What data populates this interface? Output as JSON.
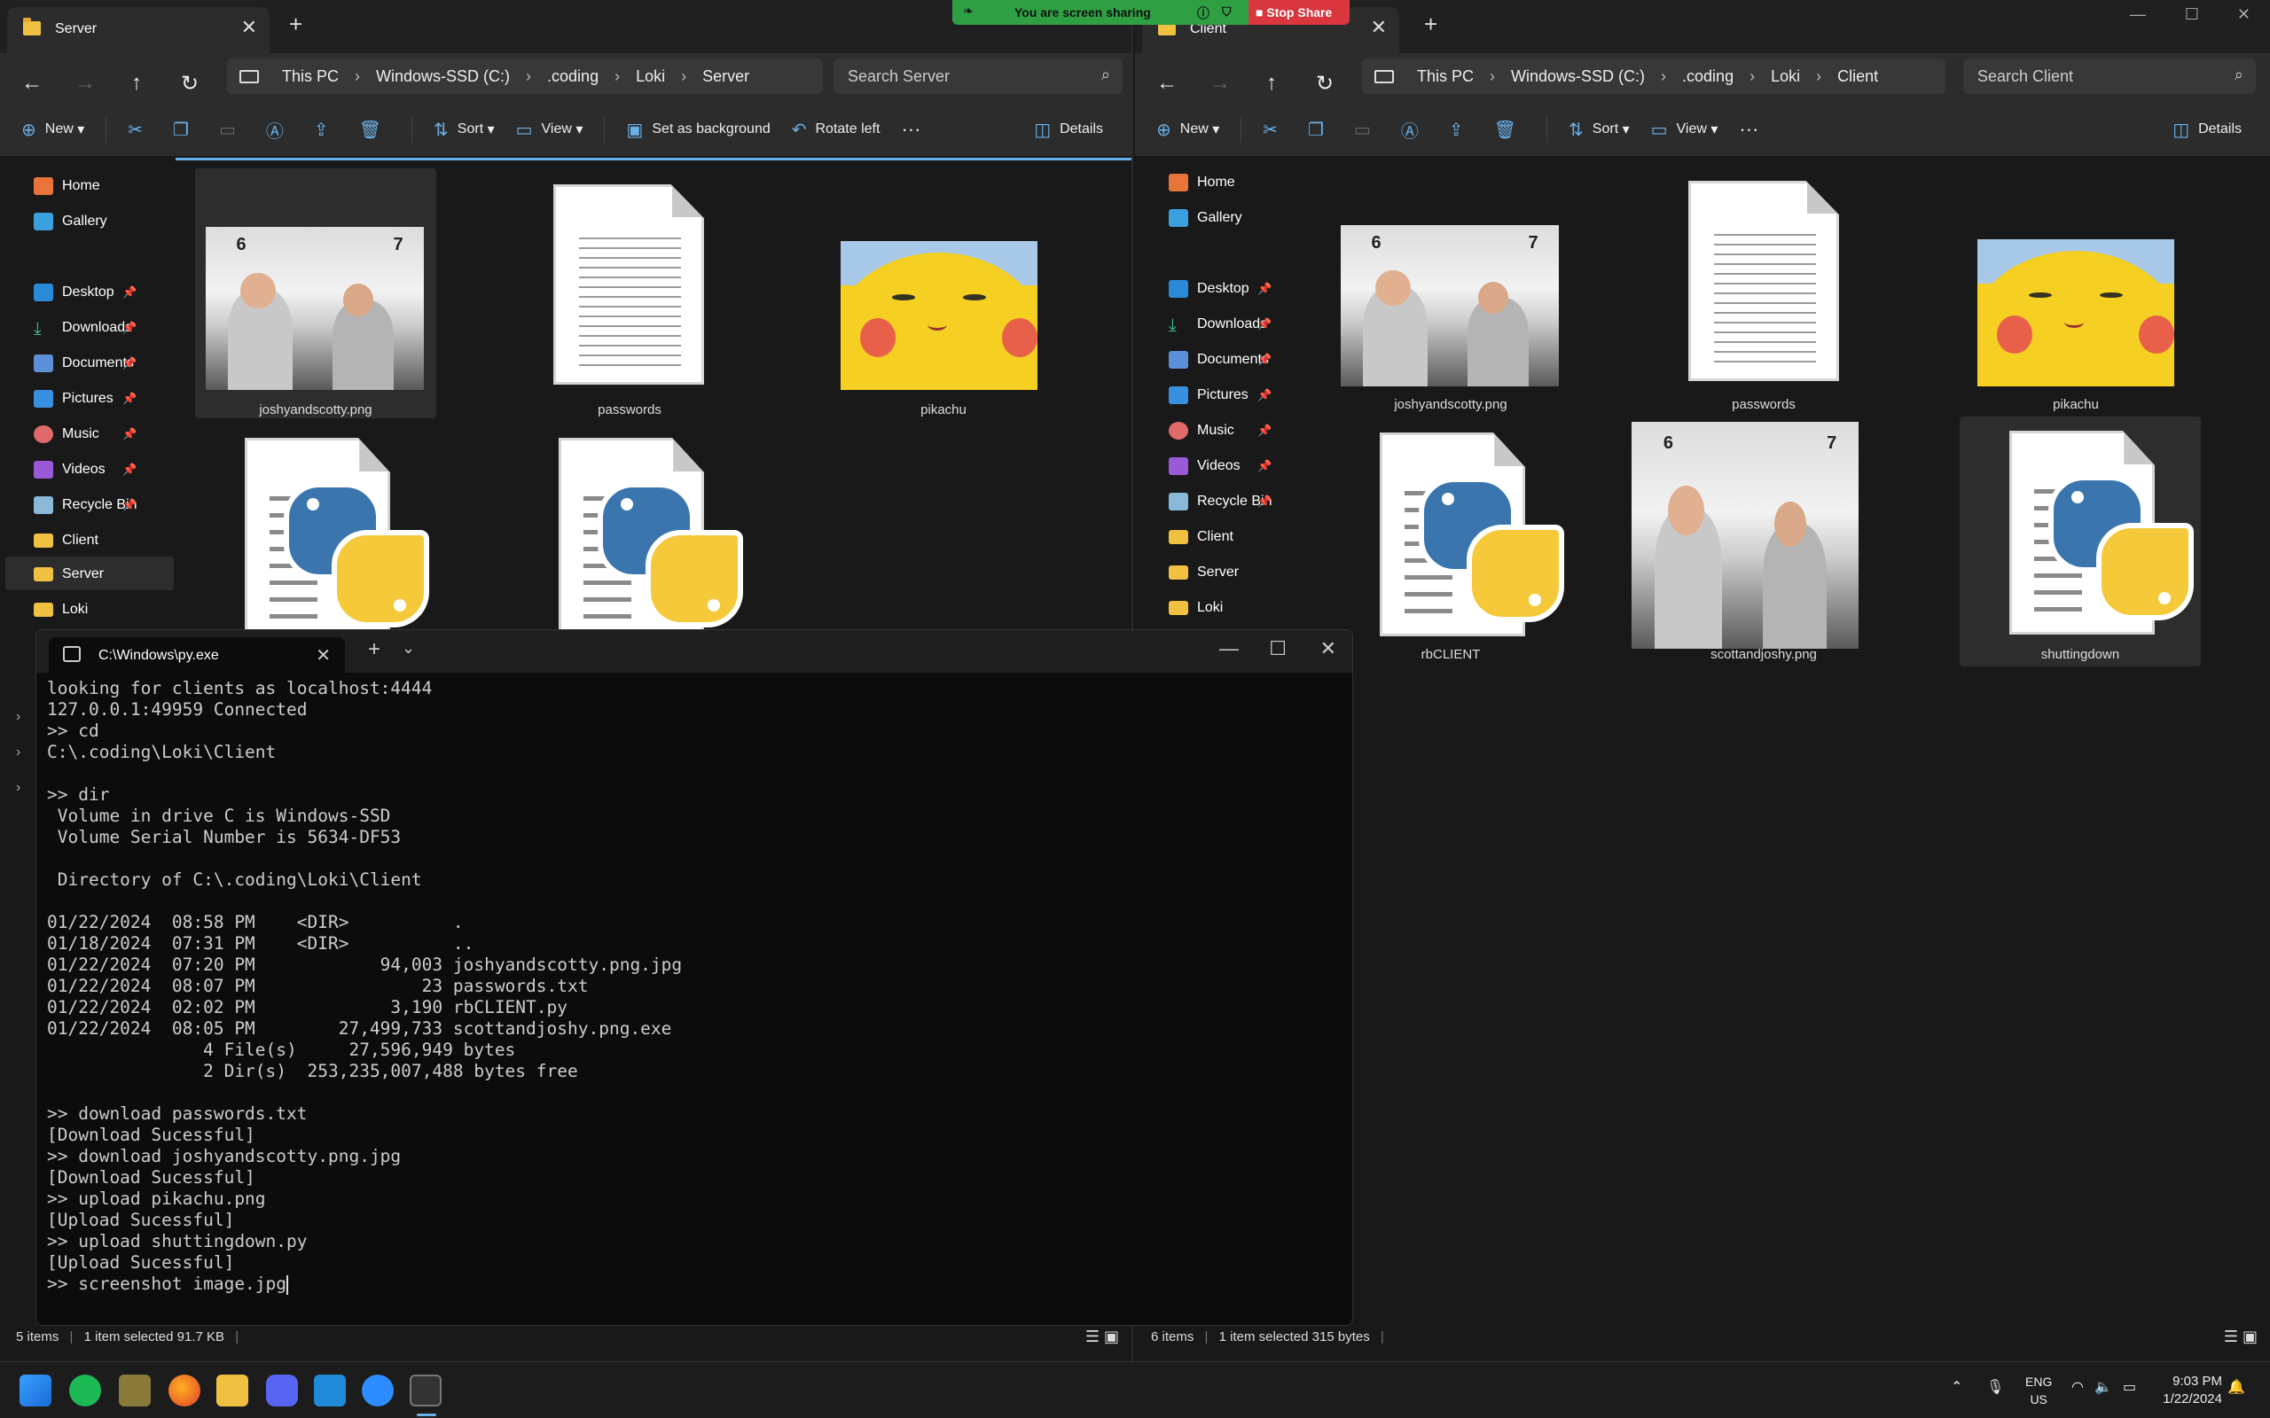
{
  "share_bar": {
    "status": "You are screen sharing",
    "stop": "Stop Share"
  },
  "left_window": {
    "tab_title": "Server",
    "breadcrumb": [
      "This PC",
      "Windows-SSD (C:)",
      ".coding",
      "Loki",
      "Server"
    ],
    "search_placeholder": "Search Server",
    "toolbar": {
      "new": "New",
      "sort": "Sort",
      "view": "View",
      "set_background": "Set as background",
      "rotate_left": "Rotate left",
      "details": "Details"
    },
    "nav": {
      "home": "Home",
      "gallery": "Gallery",
      "desktop": "Desktop",
      "downloads": "Downloads",
      "documents": "Documents",
      "pictures": "Pictures",
      "music": "Music",
      "videos": "Videos",
      "recycle": "Recycle Bin",
      "client": "Client",
      "server": "Server",
      "loki": "Loki"
    },
    "files": [
      "joshyandscotty.png",
      "passwords",
      "pikachu"
    ],
    "status": {
      "count": "5 items",
      "selected": "1 item selected  91.7 KB"
    }
  },
  "right_window": {
    "tab_title": "Client",
    "breadcrumb": [
      "This PC",
      "Windows-SSD (C:)",
      ".coding",
      "Loki",
      "Client"
    ],
    "search_placeholder": "Search Client",
    "toolbar": {
      "new": "New",
      "sort": "Sort",
      "view": "View",
      "details": "Details"
    },
    "nav": {
      "home": "Home",
      "gallery": "Gallery",
      "desktop": "Desktop",
      "downloads": "Downloads",
      "documents": "Documents",
      "pictures": "Pictures",
      "music": "Music",
      "videos": "Videos",
      "recycle": "Recycle Bin",
      "client": "Client",
      "server": "Server",
      "loki": "Loki"
    },
    "files": [
      "joshyandscotty.png",
      "passwords",
      "pikachu",
      "rbCLIENT",
      "scottandjoshy.png",
      "shuttingdown"
    ],
    "status": {
      "count": "6 items",
      "selected": "1 item selected  315 bytes"
    }
  },
  "terminal": {
    "tab_title": "C:\\Windows\\py.exe",
    "output": "looking for clients as localhost:4444\n127.0.0.1:49959 Connected\n>> cd\nC:\\.coding\\Loki\\Client\n\n>> dir\n Volume in drive C is Windows-SSD\n Volume Serial Number is 5634-DF53\n\n Directory of C:\\.coding\\Loki\\Client\n\n01/22/2024  08:58 PM    <DIR>          .\n01/18/2024  07:31 PM    <DIR>          ..\n01/22/2024  07:20 PM            94,003 joshyandscotty.png.jpg\n01/22/2024  08:07 PM                23 passwords.txt\n01/22/2024  02:02 PM             3,190 rbCLIENT.py\n01/22/2024  08:05 PM        27,499,733 scottandjoshy.png.exe\n               4 File(s)     27,596,949 bytes\n               2 Dir(s)  253,235,007,488 bytes free\n\n>> download passwords.txt\n[Download Sucessful]\n>> download joshyandscotty.png.jpg\n[Download Sucessful]\n>> upload pikachu.png\n[Upload Sucessful]\n>> upload shuttingdown.py\n[Upload Sucessful]\n>> screenshot image.jpg"
  },
  "taskbar": {
    "lang": "ENG",
    "region": "US",
    "time": "9:03 PM",
    "date": "1/22/2024"
  },
  "colors": {
    "accent": "#6ab0e8",
    "share_green": "#2ea043",
    "share_red": "#d9363e"
  }
}
